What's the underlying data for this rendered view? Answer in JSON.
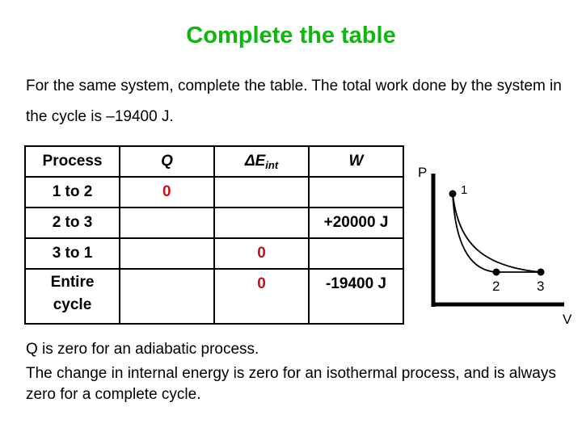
{
  "title": "Complete the table",
  "intro": "For the same system, complete the table. The total work done by the system in the cycle is –19400 J.",
  "table": {
    "headers": {
      "process": "Process",
      "q": "Q",
      "delta_e_main": "ΔE",
      "delta_e_sub": "int",
      "w": "W"
    },
    "rows": [
      {
        "process": "1 to 2",
        "q": "0",
        "delta_e": "",
        "w": ""
      },
      {
        "process": "2 to 3",
        "q": "",
        "delta_e": "",
        "w": "+20000 J"
      },
      {
        "process": "3 to 1",
        "q": "",
        "delta_e": "0",
        "w": ""
      },
      {
        "process_line1": "Entire",
        "process_line2": "cycle",
        "q": "",
        "delta_e": "0",
        "w": "-19400 J"
      }
    ]
  },
  "diagram": {
    "y_axis_label": "P",
    "x_axis_label": "V",
    "points": [
      {
        "label": "1"
      },
      {
        "label": "2"
      },
      {
        "label": "3"
      }
    ]
  },
  "notes": {
    "line1": "Q is zero for an adiabatic process.",
    "line2": "The change in internal energy is zero for an isothermal process, and is always zero for a complete cycle."
  },
  "colors": {
    "title": "#11b511",
    "answer": "#c0141a",
    "text": "#000000"
  }
}
